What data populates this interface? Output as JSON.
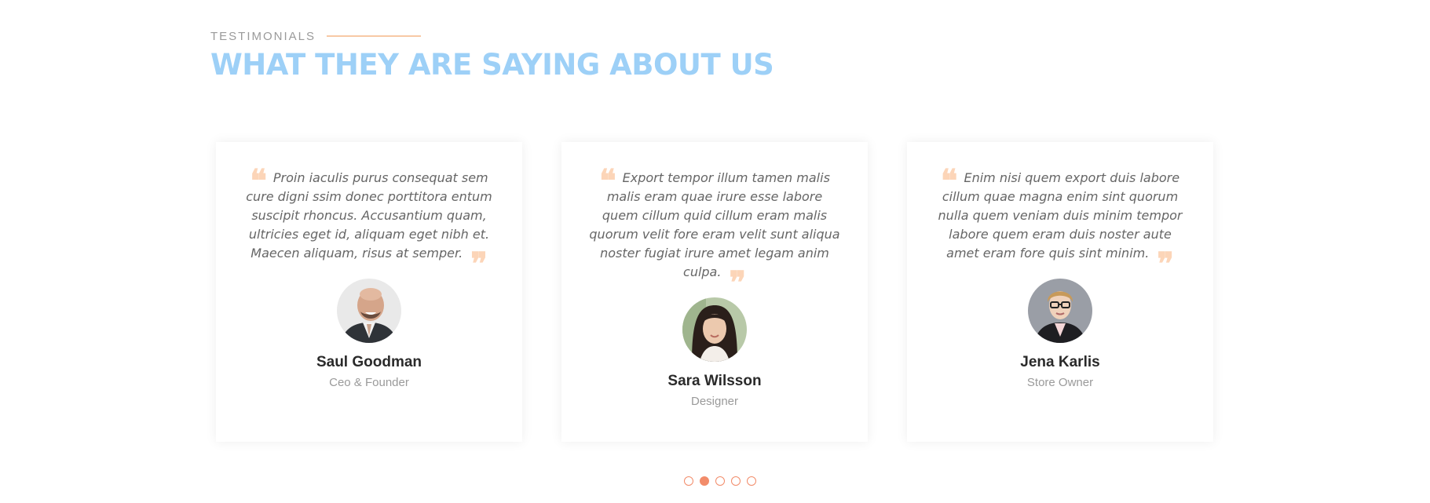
{
  "section": {
    "eyebrow": "TESTIMONIALS",
    "title": "WHAT THEY ARE SAYING ABOUT US"
  },
  "testimonials": [
    {
      "quote": "Proin iaculis purus consequat sem cure digni ssim donec porttitora entum suscipit rhoncus. Accusantium quam, ultricies eget id, aliquam eget nibh et. Maecen aliquam, risus at semper.",
      "name": "Saul Goodman",
      "role": "Ceo & Founder"
    },
    {
      "quote": "Export tempor illum tamen malis malis eram quae irure esse labore quem cillum quid cillum eram malis quorum velit fore eram velit sunt aliqua noster fugiat irure amet legam anim culpa.",
      "name": "Sara Wilsson",
      "role": "Designer"
    },
    {
      "quote": "Enim nisi quem export duis labore cillum quae magna enim sint quorum nulla quem veniam duis minim tempor labore quem eram duis noster aute amet eram fore quis sint minim.",
      "name": "Jena Karlis",
      "role": "Store Owner"
    }
  ],
  "icons": {
    "open_quote": "❝",
    "close_quote": "❞"
  },
  "pagination": {
    "count": 5,
    "active_index": 1
  },
  "colors": {
    "accent": "#f28c6a",
    "title": "#9dd0f7",
    "quote_mark": "#fcd5b8",
    "eyebrow_line": "#f8c9a5"
  }
}
